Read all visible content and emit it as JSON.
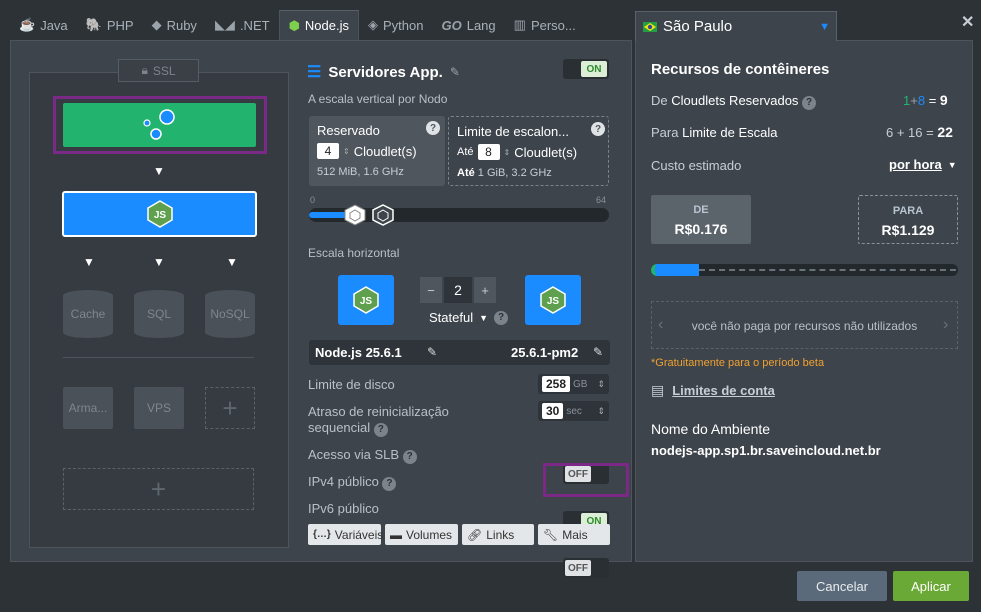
{
  "tabs": [
    {
      "label": "Java",
      "icon": "java-icon"
    },
    {
      "label": "PHP",
      "icon": "php-icon"
    },
    {
      "label": "Ruby",
      "icon": "ruby-icon"
    },
    {
      "label": ".NET",
      "icon": "dotnet-icon"
    },
    {
      "label": "Node.js",
      "icon": "nodejs-icon",
      "active": true
    },
    {
      "label": "Python",
      "icon": "python-icon"
    },
    {
      "label": "Lang",
      "icon": "go-icon",
      "prefix": "GO"
    },
    {
      "label": "Perso...",
      "icon": "custom-icon"
    }
  ],
  "topology": {
    "ssl_label": "SSL",
    "databases": [
      "Cache",
      "SQL",
      "NoSQL"
    ],
    "extras": [
      "Arma...",
      "VPS"
    ]
  },
  "config": {
    "title": "Servidores App.",
    "toggle_on": "ON",
    "vertical_label": "A escala vertical por Nodo",
    "reserved": {
      "title": "Reservado",
      "value": "4",
      "unit": "Cloudlet(s)",
      "spec": "512 MiB, 1.6 GHz"
    },
    "limit": {
      "title": "Limite de escalon...",
      "prefix": "Até",
      "value": "8",
      "unit": "Cloudlet(s)",
      "spec_prefix": "Até",
      "spec": "1 GiB, 3.2 GHz"
    },
    "slider": {
      "min": "0",
      "max": "64",
      "reserved": 4,
      "limit": 8
    },
    "horizontal_label": "Escala horizontal",
    "node_count": "2",
    "minus": "−",
    "plus": "+",
    "mode": "Stateful",
    "engine": "Node.js 25.6.1",
    "engine_tag": "25.6.1-pm2",
    "disk": {
      "label": "Limite de disco",
      "value": "258",
      "unit": "GB"
    },
    "restart": {
      "label": "Atraso de reinicialização sequencial",
      "value": "30",
      "unit": "sec"
    },
    "slb": {
      "label": "Acesso via SLB",
      "state": "OFF"
    },
    "ipv4": {
      "label": "IPv4 público",
      "state": "ON"
    },
    "ipv6": {
      "label": "IPv6 público",
      "state": "OFF"
    },
    "buttons": [
      {
        "label": "Variáveis",
        "icon": "braces-icon"
      },
      {
        "label": "Volumes",
        "icon": "folder-icon"
      },
      {
        "label": "Links",
        "icon": "link-icon"
      },
      {
        "label": "Mais",
        "icon": "wrench-icon"
      }
    ]
  },
  "region": {
    "name": "São Paulo",
    "flag": "brazil-flag-icon"
  },
  "resources": {
    "title": "Recursos de contêineres",
    "reserved_label_a": "De",
    "reserved_label_b": "Cloudlets Reservados",
    "reserved_a": "1",
    "reserved_plus": "+",
    "reserved_b": "8",
    "reserved_eq": "=",
    "reserved_total": "9",
    "scaling_label_a": "Para",
    "scaling_label_b": "Limite de Escala",
    "scaling_expr": "6 + 16 =",
    "scaling_total": "22",
    "cost_label": "Custo estimado",
    "cost_period": "por hora",
    "from_label": "DE",
    "from_value": "R$0.176",
    "to_label": "PARA",
    "to_value": "R$1.129",
    "note": "você não paga por recursos não utilizados",
    "beta": "*Gratuitamente para o período beta",
    "limits_link": "Limites de conta",
    "env_label": "Nome do Ambiente",
    "env_name": "nodejs-app.sp1.br.saveincloud.net.br"
  },
  "footer": {
    "cancel": "Cancelar",
    "apply": "Aplicar"
  },
  "colors": {
    "accent_blue": "#1a8cff",
    "balancer_green": "#22b46e",
    "apply_green": "#6aa935",
    "highlight_purple": "#7a2a86",
    "beta_orange": "#f0a030"
  }
}
